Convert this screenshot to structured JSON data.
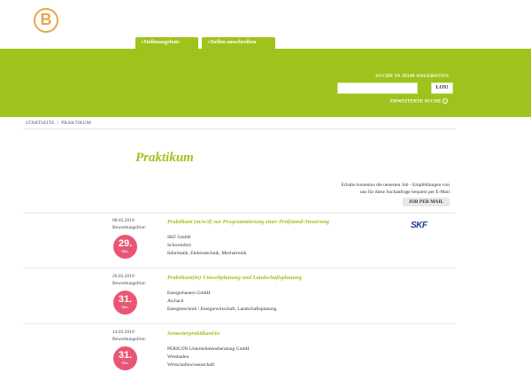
{
  "logo": {
    "letter": "B"
  },
  "tabs": [
    "+Stellenangebote",
    "+Stellen ausschreiben"
  ],
  "search": {
    "title": "SUCHE IN 28148 ANGEBOTEN",
    "button": "LOS!",
    "input_value": "",
    "advanced": "ERWEITERTE SUCHE",
    "advanced_icon": "circle-arrow-icon"
  },
  "breadcrumb": {
    "home": "STARTSEITE",
    "separator": "/",
    "current": "PRAKTIKUM"
  },
  "page": {
    "title": "Praktikum"
  },
  "job_mail": {
    "text_line1": "Erhalte kostenlos die neuesten Job - Empfehlungen von",
    "text_line2": "uns für diese Suchanfrage bequem per E-Mail",
    "button": "JOB PER MAIL"
  },
  "deadline_label": "Bewerbungsfrist:",
  "jobs": [
    {
      "date": "08.03.2019",
      "deadline_day": "29.",
      "deadline_month": "Mär.",
      "title": "Praktikant (m/w/d) zur Programmierung einer Prüfstand-Steuerung",
      "company": "SKF GmbH",
      "location": "Schweinfurt",
      "field": "Informatik, Elektrotechnik, Mechatronik",
      "logo_text": "SKF"
    },
    {
      "date": "20.03.2019",
      "deadline_day": "31.",
      "deadline_month": "Mär.",
      "title": "Praktikant(in) Umweltplanung und Landschaftsplanung",
      "company": "Energiebauern GmbH",
      "location": "Aichach",
      "field": "Energietechnik / Energiewirtschaft, Landschaftsplanung"
    },
    {
      "date": "14.03.2019",
      "deadline_day": "31.",
      "deadline_month": "Mär.",
      "title": "Semesterpraktikant/in",
      "company": "PERICON Unternehmensberatung GmbH",
      "location": "Wiesbaden",
      "field": "Wirtschaftswissenschaft"
    }
  ],
  "colors": {
    "accent": "#9fc31c",
    "badge": "#e95673",
    "logo": "#e8a74a",
    "skf": "#1f3f8f"
  }
}
